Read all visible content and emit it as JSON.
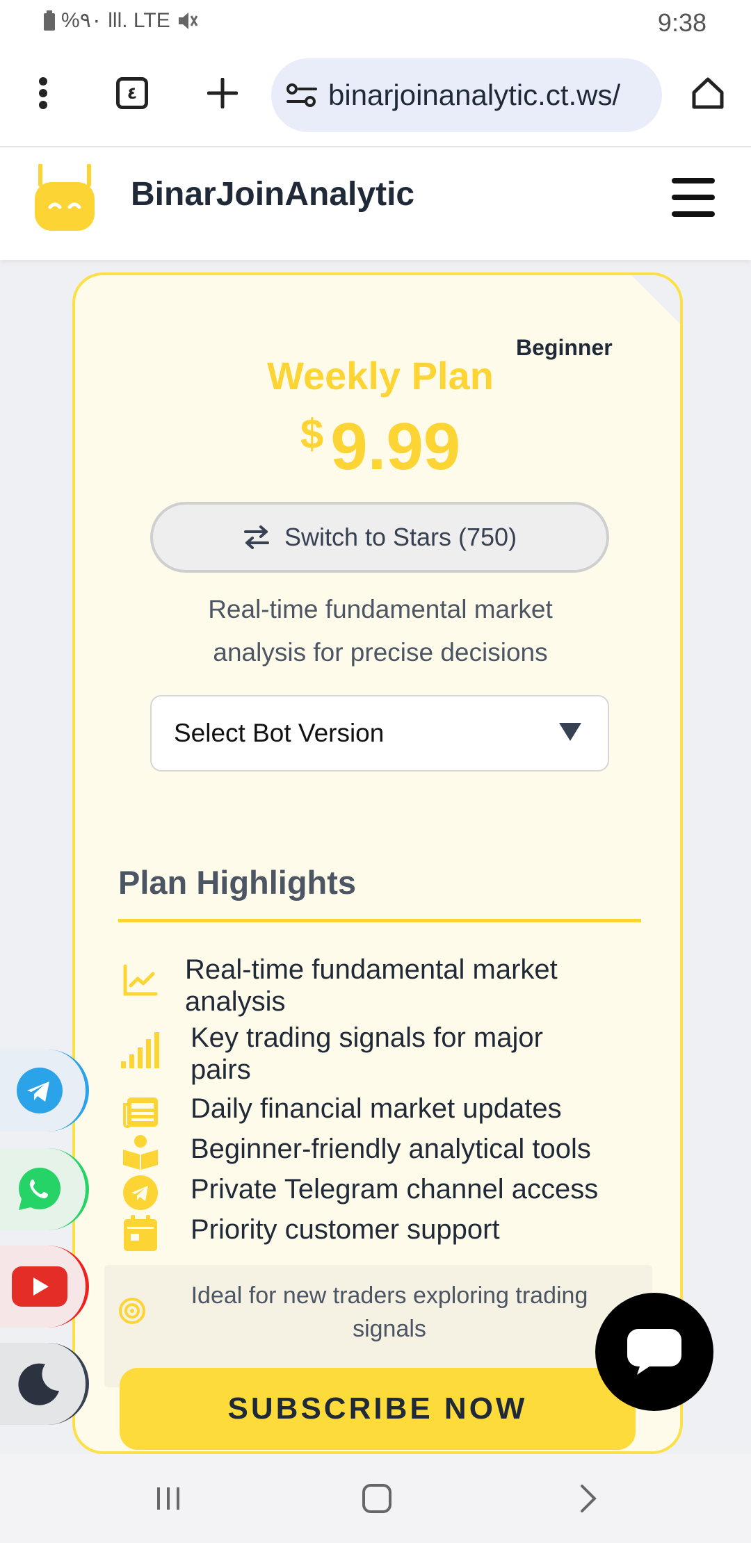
{
  "status": {
    "left": "%٩٠ lll. LTE",
    "time": "9:38"
  },
  "browser": {
    "url": "binarjoinanalytic.ct.ws/",
    "tab_count": "٤"
  },
  "site": {
    "brand": "BinarJoinAnalytic"
  },
  "plan": {
    "badge": "Beginner",
    "title": "Weekly Plan",
    "currency": "$",
    "price": "9.99",
    "switch_label": "Switch to Stars (750)",
    "description": "Real-time fundamental market analysis for precise decisions",
    "select_label": "Select Bot Version",
    "highlights_title": "Plan Highlights",
    "features": [
      {
        "icon": "chart-line-icon",
        "text": "Real-time fundamental market analysis"
      },
      {
        "icon": "signal-bars-icon",
        "text": "Key trading signals for major pairs"
      },
      {
        "icon": "newspaper-icon",
        "text": "Daily financial market updates"
      },
      {
        "icon": "book-reader-icon",
        "text": "Beginner-friendly analytical tools"
      },
      {
        "icon": "telegram-icon",
        "text": "Private Telegram channel access"
      },
      {
        "icon": "calendar-icon",
        "text": "Priority customer support"
      }
    ],
    "ideal_text": "Ideal for new traders exploring trading signals",
    "subscribe_label": "SUBSCRIBE NOW"
  },
  "colors": {
    "accent": "#fcd535",
    "card_bg": "#fffbea",
    "button": "#fddb3a"
  }
}
